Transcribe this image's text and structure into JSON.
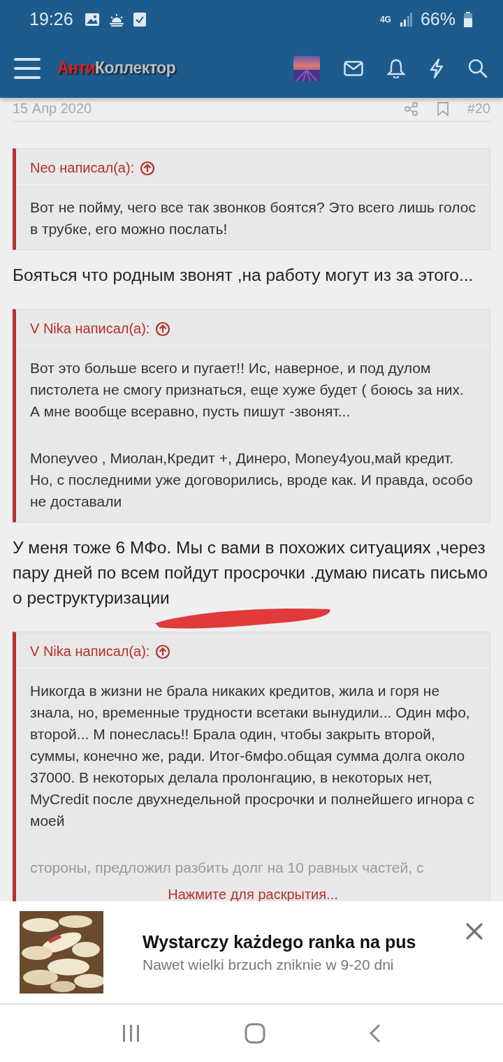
{
  "status_bar": {
    "time": "19:26",
    "network": "4G",
    "battery": "66%"
  },
  "header": {
    "logo": {
      "part_1": "Анти",
      "part_2": "Коллектор"
    }
  },
  "post_meta": {
    "date": "15 Апр 2020",
    "number": "#20"
  },
  "blocks": [
    {
      "kind": "quote",
      "author": "Neo написал(а):",
      "paragraphs": [
        "Вот не пойму, чего все так звонков боятся? Это всего лишь голос в трубке, его можно послать!"
      ]
    },
    {
      "kind": "text",
      "text": "Бояться что родным звонят ,на работу могут из за этого..."
    },
    {
      "kind": "quote",
      "author": "V Nika написал(а):",
      "paragraphs": [
        "Вот это больше всего и пугает!! Ис, наверное, и под дулом пистолета не смогу признаться, еще хуже будет ( боюсь за них. А мне вообще всеравно, пусть пишут -звонят...",
        "Moneyveo , Миолан,Кредит +, Динеро, Money4you,май кредит. Но, с последними уже договорились, вроде как. И правда, особо не доставали"
      ]
    },
    {
      "kind": "text",
      "text": "У меня тоже 6 МФо. Мы с вами в похожих ситуациях ,через пару дней по всем пойдут просрочки .думаю писать письмо о реструктуризации",
      "scribble": true
    },
    {
      "kind": "quote",
      "author": "V Nika написал(а):",
      "paragraphs": [
        "Никогда в жизни не брала никаких кредитов, жила и горя не знала, но, временные трудности всетаки вынудили... Один мфо, второй... М понеслась!! Брала один, чтобы закрыть второй, суммы, конечно же, ради. Итог-6мфо.общая сумма долга около 37000. В некоторых делала пролонгацию, в некоторых нет, MyCredit после двухнедельной просрочки и полнейшего игнора с моей"
      ],
      "faded_text": "стороны, предложил разбить долг на 10 равных частей, с",
      "expand_label": "Нажмите для раскрытия..."
    }
  ],
  "ad": {
    "kind": "picture",
    "title": "Wystarczy każdego ranka na pus",
    "subtitle": "Nawet wielki brzuch zniknie w 9-20 dni"
  }
}
